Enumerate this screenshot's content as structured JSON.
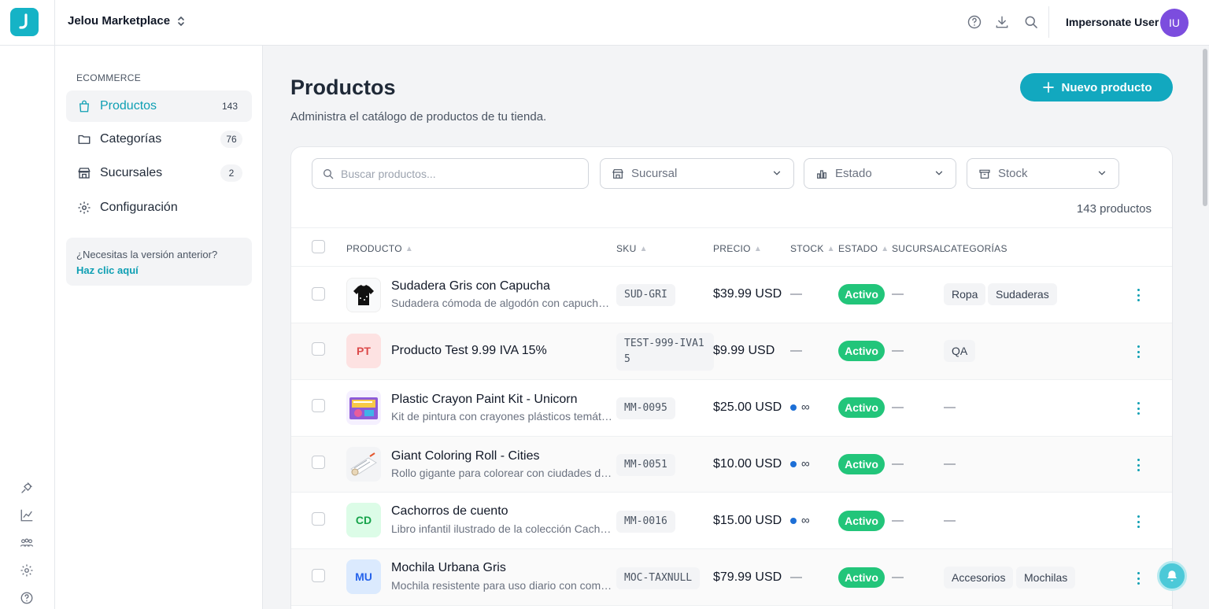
{
  "app": {
    "workspace": "Jelou Marketplace",
    "user_name": "Impersonate User",
    "user_initials": "IU"
  },
  "topbar_icons": [
    "help-icon",
    "download-icon",
    "search-icon"
  ],
  "rail_icons": [
    "plug-icon",
    "chart-icon",
    "users-icon",
    "settings-icon",
    "help-icon"
  ],
  "sidebar": {
    "section": "ECOMMERCE",
    "items": [
      {
        "label": "Productos",
        "count": "143",
        "icon": "shopping-bag-icon",
        "active": true
      },
      {
        "label": "Categorías",
        "count": "76",
        "icon": "folder-icon",
        "active": false
      },
      {
        "label": "Sucursales",
        "count": "2",
        "icon": "store-icon",
        "active": false
      },
      {
        "label": "Configuración",
        "count": "",
        "icon": "gear-icon",
        "active": false
      }
    ],
    "legacy_question": "¿Necesitas la versión anterior?",
    "legacy_link": "Haz clic aquí"
  },
  "page": {
    "title": "Productos",
    "subtitle": "Administra el catálogo de productos de tu tienda.",
    "new_button": "Nuevo producto"
  },
  "filters": {
    "search_placeholder": "Buscar productos...",
    "branch": "Sucursal",
    "status": "Estado",
    "stock": "Stock"
  },
  "result_count": "143 productos",
  "table": {
    "columns": [
      "PRODUCTO",
      "SKU",
      "PRECIO",
      "STOCK",
      "ESTADO",
      "SUCURSAL",
      "CATEGORÍAS"
    ],
    "rows": [
      {
        "name": "Sudadera Gris con Capucha",
        "desc": "Sudadera cómoda de algodón con capucha y bolsillo frontal",
        "thumb": "hoodie-image",
        "initials": "",
        "sku": "SUD-GRI",
        "price": "$39.99 USD",
        "stock": "—",
        "status": "Activo",
        "branch": "—",
        "categories": [
          "Ropa",
          "Sudaderas"
        ]
      },
      {
        "name": "Producto Test 9.99 IVA 15%",
        "desc": "",
        "thumb": "initials",
        "initials": "PT",
        "sku": "TEST-999-IVA15",
        "price": "$9.99 USD",
        "stock": "—",
        "status": "Activo",
        "branch": "—",
        "categories": [
          "QA"
        ]
      },
      {
        "name": "Plastic Crayon Paint Kit - Unicorn",
        "desc": "Kit de pintura con crayones plásticos temáticos de unicornio",
        "thumb": "crayon-kit-image",
        "initials": "",
        "sku": "MM-0095",
        "price": "$25.00 USD",
        "stock": "∞",
        "status": "Activo",
        "branch": "—",
        "categories": []
      },
      {
        "name": "Giant Coloring Roll - Cities",
        "desc": "Rollo gigante para colorear con ciudades del mundo",
        "thumb": "coloring-roll-image",
        "initials": "",
        "sku": "MM-0051",
        "price": "$10.00 USD",
        "stock": "∞",
        "status": "Activo",
        "branch": "—",
        "categories": []
      },
      {
        "name": "Cachorros de cuento",
        "desc": "Libro infantil ilustrado de la colección Cachorros",
        "thumb": "initials",
        "initials": "CD",
        "sku": "MM-0016",
        "price": "$15.00 USD",
        "stock": "∞",
        "status": "Activo",
        "branch": "—",
        "categories": []
      },
      {
        "name": "Mochila Urbana Gris",
        "desc": "Mochila resistente para uso diario con compartimentos",
        "thumb": "initials",
        "initials": "MU",
        "sku": "MOC-TAXNULL",
        "price": "$79.99 USD",
        "stock": "—",
        "status": "Activo",
        "branch": "—",
        "categories": [
          "Accesorios",
          "Mochilas"
        ]
      }
    ]
  },
  "empty_dash": "—",
  "colors": {
    "accent": "#12a8bf",
    "active_badge": "#22c57a",
    "avatar": "#7c4dde",
    "stock_dot": "#1d6fd6"
  }
}
